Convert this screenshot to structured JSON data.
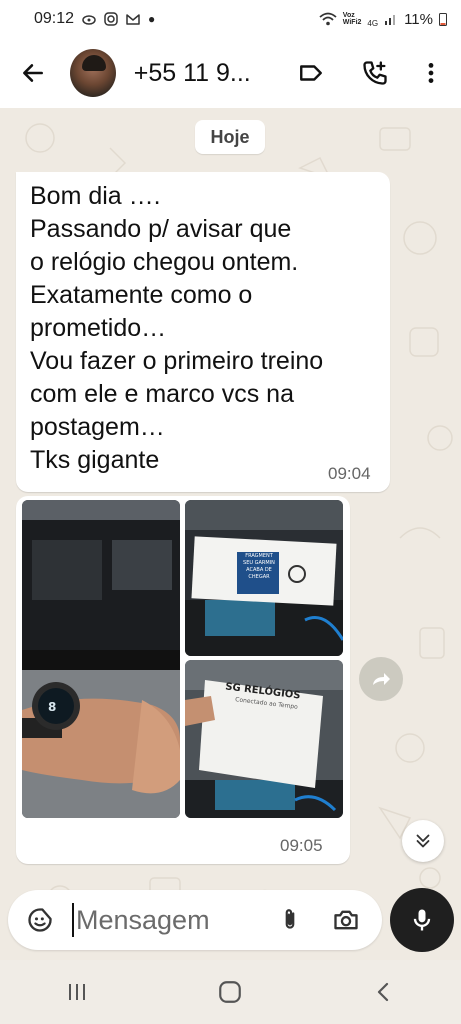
{
  "status_bar": {
    "time": "09:12",
    "network_label_top": "Voz",
    "network_label_bottom": "WiFi2",
    "signal_label": "4G",
    "battery": "11%"
  },
  "header": {
    "contact_name": "+55 11 9...",
    "icons": [
      "back-arrow",
      "label-tag",
      "add-call",
      "more-vert"
    ]
  },
  "chat": {
    "date_chip": "Hoje",
    "messages": [
      {
        "lines": [
          "Bom dia ….",
          "Passando p/ avisar que",
          "o relógio chegou ontem.",
          "Exatamente como o",
          "prometido…",
          "Vou fazer o primeiro treino",
          "com ele e marco vcs na",
          "postagem…",
          "Tks gigante"
        ],
        "time": "09:04"
      },
      {
        "type": "image_album",
        "photo_count": 3,
        "photo_texts": {
          "box_brand": "SG RELÓGIOS",
          "box_subtitle": "Conectado ao Tempo",
          "card_text": "FRAGMENT",
          "card_subtitle_1": "SEU GARMIN",
          "card_subtitle_2": "ACABA DE CHEGAR"
        },
        "time": "09:05"
      }
    ]
  },
  "composer": {
    "placeholder": "Mensagem"
  },
  "colors": {
    "chat_bg": "#efeae2",
    "bubble": "#ffffff",
    "mic_button": "#1f1f1f"
  }
}
